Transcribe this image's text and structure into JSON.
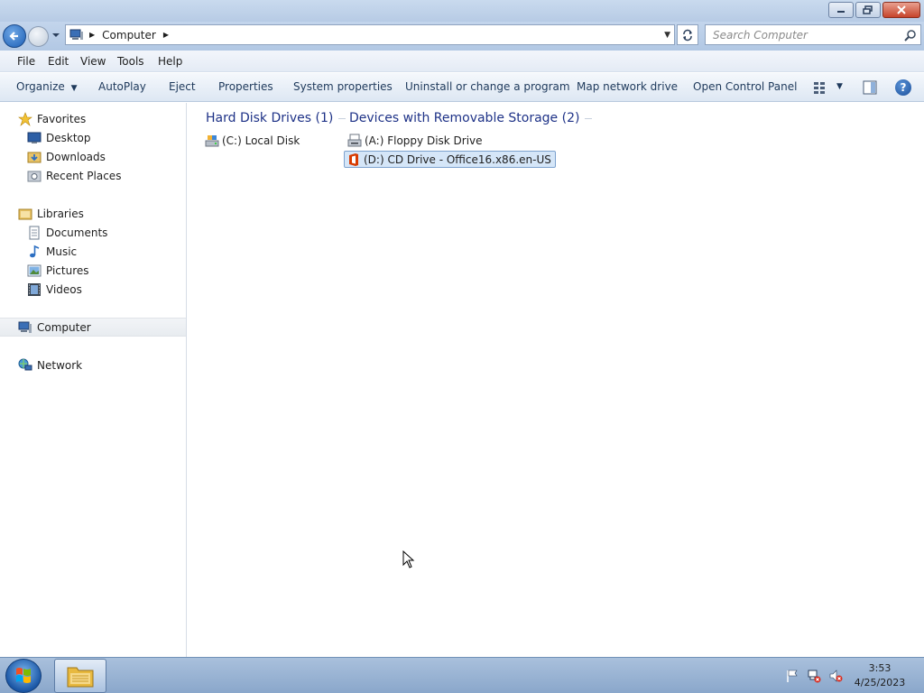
{
  "window": {
    "title": ""
  },
  "address": {
    "location": "Computer"
  },
  "search": {
    "placeholder": "Search Computer"
  },
  "menu": [
    {
      "label": "File"
    },
    {
      "label": "Edit"
    },
    {
      "label": "View"
    },
    {
      "label": "Tools"
    },
    {
      "label": "Help"
    }
  ],
  "commands": {
    "organize": "Organize",
    "autoplay": "AutoPlay",
    "eject": "Eject",
    "properties": "Properties",
    "system_properties": "System properties",
    "uninstall": "Uninstall or change a program",
    "map_drive": "Map network drive",
    "control_panel": "Open Control Panel",
    "help": "?"
  },
  "nav": {
    "favorites": "Favorites",
    "desktop": "Desktop",
    "downloads": "Downloads",
    "recent": "Recent Places",
    "libraries": "Libraries",
    "documents": "Documents",
    "music": "Music",
    "pictures": "Pictures",
    "videos": "Videos",
    "computer": "Computer",
    "network": "Network"
  },
  "groups": {
    "hdd": {
      "title": "Hard Disk Drives (1)"
    },
    "removable": {
      "title": "Devices with Removable Storage (2)"
    }
  },
  "drives": {
    "c": "(C:) Local Disk",
    "a": "(A:) Floppy Disk Drive",
    "d": "(D:) CD Drive - Office16.x86.en-US"
  },
  "clock": {
    "time": "3:53",
    "date": "4/25/2023"
  },
  "colors": {
    "accent": "#1e3287",
    "selection": "#d5e6f8",
    "office_red": "#d83b01"
  }
}
